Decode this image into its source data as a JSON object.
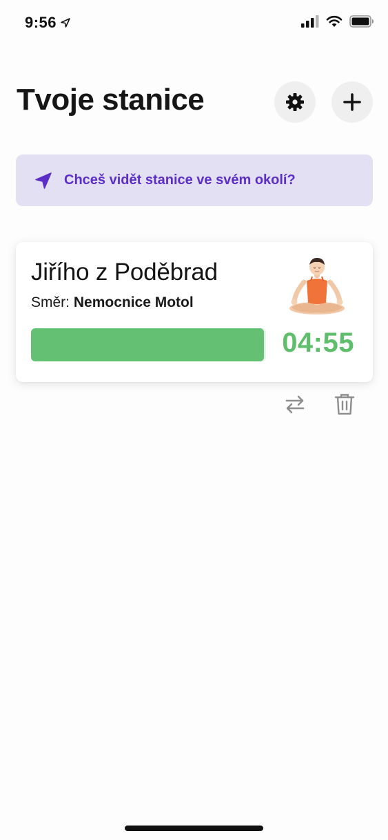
{
  "status_bar": {
    "time": "9:56",
    "icons": [
      "location-arrow-icon",
      "cellular-signal-icon",
      "wifi-icon",
      "battery-icon"
    ]
  },
  "header": {
    "title": "Tvoje stanice",
    "settings_icon": "gear-icon",
    "add_icon": "plus-icon"
  },
  "location_banner": {
    "text": "Chceš vidět stanice ve svém okolí?",
    "icon": "navigation-arrow-icon",
    "color": "#5b2fc5",
    "background": "#e4e0f3"
  },
  "stations": [
    {
      "name": "Jiřího z Poděbrad",
      "direction_label": "Směr:",
      "direction_value": "Nemocnice Motol",
      "mood_icon": "person-meditating-emoji",
      "countdown": "04:55",
      "progress_fraction": 0.99,
      "accent_color": "#64c072",
      "actions": [
        "swap-direction-icon",
        "trash-icon"
      ]
    }
  ]
}
